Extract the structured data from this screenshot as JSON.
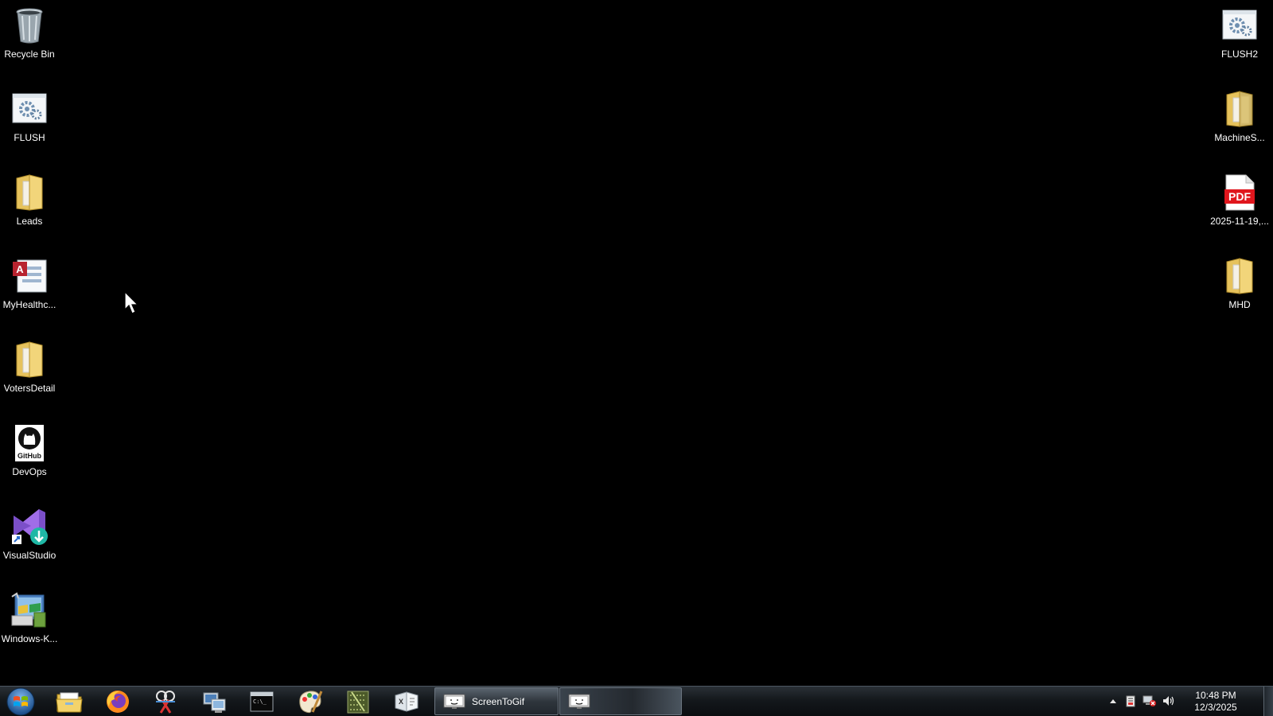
{
  "desktop": {
    "left_icons": [
      {
        "label": "Recycle Bin",
        "icon": "recycle-bin-icon"
      },
      {
        "label": "FLUSH",
        "icon": "batch-file-icon"
      },
      {
        "label": "Leads",
        "icon": "folder-icon"
      },
      {
        "label": "MyHealthc...",
        "icon": "access-database-icon"
      },
      {
        "label": "VotersDetail",
        "icon": "folder-icon"
      },
      {
        "label": "DevOps",
        "icon": "github-icon"
      },
      {
        "label": "VisualStudio",
        "icon": "visual-studio-installer-icon"
      },
      {
        "label": "Windows-K...",
        "icon": "windows-kit-icon"
      }
    ],
    "right_icons": [
      {
        "label": "FLUSH2",
        "icon": "batch-file-icon"
      },
      {
        "label": "MachineS...",
        "icon": "folder-icon"
      },
      {
        "label": "2025-11-19,...",
        "icon": "pdf-icon",
        "badge": "PDF"
      },
      {
        "label": "MHD",
        "icon": "folder-icon"
      }
    ]
  },
  "taskbar": {
    "start_icon": "windows-start-orb-icon",
    "pinned": [
      {
        "name": "file-explorer-icon"
      },
      {
        "name": "firefox-icon"
      },
      {
        "name": "snipping-tool-icon"
      },
      {
        "name": "remote-desktop-icon"
      },
      {
        "name": "command-prompt-icon"
      },
      {
        "name": "paint-icon"
      },
      {
        "name": "notepad-plus-icon"
      },
      {
        "name": "xps-viewer-icon"
      }
    ],
    "tasks": [
      {
        "label": "ScreenToGif",
        "icon": "screentogif-icon"
      },
      {
        "label": "",
        "icon": "screentogif-icon"
      }
    ],
    "tray": {
      "icons": [
        "show-hidden-icons-chevron",
        "action-center-icon",
        "network-icon",
        "volume-icon"
      ]
    },
    "clock": {
      "time": "10:48 PM",
      "date": "12/3/2025"
    }
  }
}
